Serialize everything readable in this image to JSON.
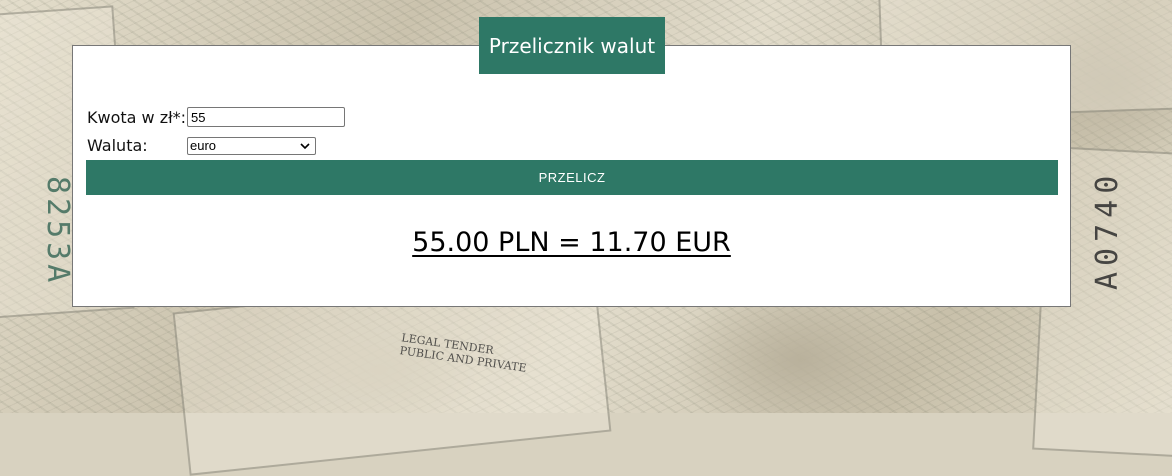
{
  "header": {
    "title": "Przelicznik walut"
  },
  "form": {
    "amount_label": "Kwota w zł*:",
    "amount_value": "55",
    "currency_label": "Waluta:",
    "currency_selected": "euro",
    "convert_label": "PRZELICZ"
  },
  "result": {
    "text": "55.00 PLN = 11.70 EUR"
  },
  "background": {
    "serial_left": "8253A",
    "serial_right": "A0740",
    "tender_line_1": "LEGAL TENDER",
    "tender_line_2": "PUBLIC AND PRIVATE"
  },
  "colors": {
    "accent": "#2e7866",
    "panel_bg": "#ffffff",
    "panel_border": "#777777"
  },
  "icons": {
    "select_arrow": "chevron-down-icon"
  }
}
